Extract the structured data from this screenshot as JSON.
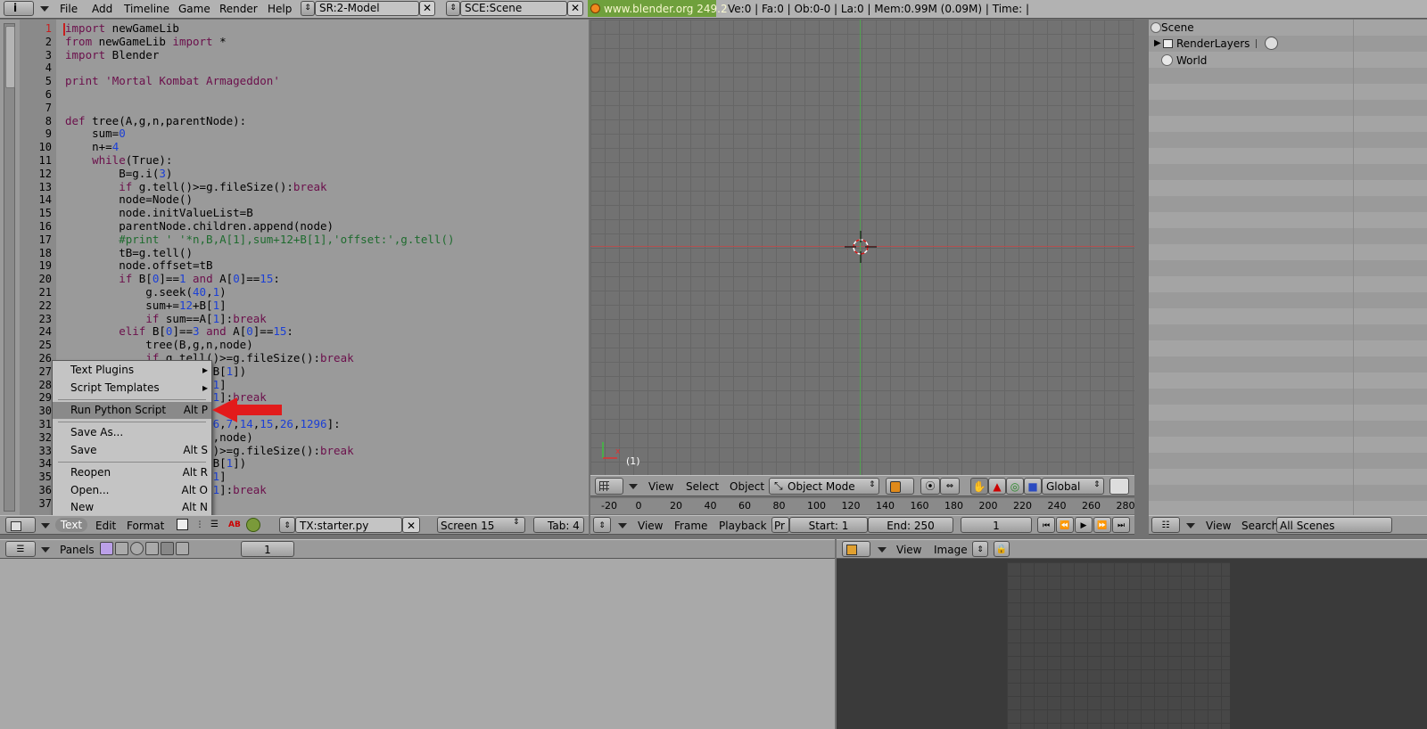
{
  "topbar": {
    "menus": [
      "File",
      "Add",
      "Timeline",
      "Game",
      "Render",
      "Help"
    ],
    "screen_field": "SR:2-Model",
    "scene_field": "SCE:Scene",
    "website": "www.blender.org 249.2",
    "stats": "Ve:0 | Fa:0 | Ob:0-0 | La:0  | Mem:0.99M (0.09M)  | Time: |"
  },
  "code_lines": [
    {
      "n": "1",
      "html": "<span class=\"kw\">import</span> newGameLib"
    },
    {
      "n": "2",
      "html": "<span class=\"kw\">from</span> newGameLib <span class=\"kw\">import</span> *"
    },
    {
      "n": "3",
      "html": "<span class=\"kw\">import</span> Blender"
    },
    {
      "n": "4",
      "html": ""
    },
    {
      "n": "5",
      "html": "<span class=\"kw\">print</span> <span class=\"str\">'Mortal Kombat Armageddon'</span>"
    },
    {
      "n": "6",
      "html": ""
    },
    {
      "n": "7",
      "html": ""
    },
    {
      "n": "8",
      "html": "<span class=\"kw\">def</span> tree(A,g,n,parentNode):"
    },
    {
      "n": "9",
      "html": "    sum=<span class=\"num\">0</span>"
    },
    {
      "n": "10",
      "html": "    n+=<span class=\"num\">4</span>"
    },
    {
      "n": "11",
      "html": "    <span class=\"kw\">while</span>(True):"
    },
    {
      "n": "12",
      "html": "        B=g.i(<span class=\"num\">3</span>)"
    },
    {
      "n": "13",
      "html": "        <span class=\"kw\">if</span> g.tell()&gt;=g.fileSize():<span class=\"kw\">break</span>"
    },
    {
      "n": "14",
      "html": "        node=Node()"
    },
    {
      "n": "15",
      "html": "        node.initValueList=B"
    },
    {
      "n": "16",
      "html": "        parentNode.children.append(node)"
    },
    {
      "n": "17",
      "html": "        <span class=\"cm\">#print ' '*n,B,A[1],sum+12+B[1],'offset:',g.tell()</span>"
    },
    {
      "n": "18",
      "html": "        tB=g.tell()"
    },
    {
      "n": "19",
      "html": "        node.offset=tB"
    },
    {
      "n": "20",
      "html": "        <span class=\"kw\">if</span> B[<span class=\"num\">0</span>]==<span class=\"num\">1</span> <span class=\"kw\">and</span> A[<span class=\"num\">0</span>]==<span class=\"num\">15</span>:"
    },
    {
      "n": "21",
      "html": "            g.seek(<span class=\"num\">40</span>,<span class=\"num\">1</span>)"
    },
    {
      "n": "22",
      "html": "            sum+=<span class=\"num\">12</span>+B[<span class=\"num\">1</span>]"
    },
    {
      "n": "23",
      "html": "            <span class=\"kw\">if</span> sum==A[<span class=\"num\">1</span>]:<span class=\"kw\">break</span>"
    },
    {
      "n": "24",
      "html": "        <span class=\"kw\">elif</span> B[<span class=\"num\">0</span>]==<span class=\"num\">3</span> <span class=\"kw\">and</span> A[<span class=\"num\">0</span>]==<span class=\"num\">15</span>:"
    },
    {
      "n": "25",
      "html": "            tree(B,g,n,node)"
    },
    {
      "n": "26",
      "html": "            <span class=\"kw\">if</span> g.tell()&gt;=g.fileSize():<span class=\"kw\">break</span>"
    },
    {
      "n": "27",
      "html": "                     +B[<span class=\"num\">1</span>])"
    },
    {
      "n": "28",
      "html": "                     [<span class=\"num\">1</span>]"
    },
    {
      "n": "29",
      "html": "                     [<span class=\"num\">1</span>]:<span class=\"kw\">break</span>"
    },
    {
      "n": "30",
      "html": ""
    },
    {
      "n": "31",
      "html": "                     [<span class=\"num\">6</span>,<span class=\"num\">7</span>,<span class=\"num\">14</span>,<span class=\"num\">15</span>,<span class=\"num\">26</span>,<span class=\"num\">1296</span>]:"
    },
    {
      "n": "32",
      "html": "                     n,node)"
    },
    {
      "n": "33",
      "html": "                     ()&gt;=g.fileSize():<span class=\"kw\">break</span>"
    },
    {
      "n": "34",
      "html": "                     +B[<span class=\"num\">1</span>])"
    },
    {
      "n": "35",
      "html": "                     [<span class=\"num\">1</span>]"
    },
    {
      "n": "36",
      "html": "                     [<span class=\"num\">1</span>]:<span class=\"kw\">break</span>"
    },
    {
      "n": "37",
      "html": ""
    }
  ],
  "popup": {
    "items": [
      {
        "label": "Text Plugins",
        "shortcut": "",
        "submenu": true
      },
      {
        "label": "Script Templates",
        "shortcut": "",
        "submenu": true
      },
      {
        "label": "Run Python Script",
        "shortcut": "Alt P",
        "highlight": true
      },
      {
        "label": "Save As...",
        "shortcut": ""
      },
      {
        "label": "Save",
        "shortcut": "Alt S"
      },
      {
        "label": "Reopen",
        "shortcut": "Alt R"
      },
      {
        "label": "Open...",
        "shortcut": "Alt O"
      },
      {
        "label": "New",
        "shortcut": "Alt N"
      }
    ]
  },
  "text_header": {
    "menus": [
      "Text",
      "Edit",
      "Format"
    ],
    "file_field": "TX:starter.py",
    "font": "Screen 15",
    "tab": "Tab: 4"
  },
  "view3d": {
    "frame_label": "(1)",
    "axis_x": "x",
    "menus": [
      "View",
      "Select",
      "Object"
    ],
    "mode": "Object Mode",
    "orientation": "Global"
  },
  "timeline": {
    "ticks": [
      "-20",
      "0",
      "20",
      "40",
      "60",
      "80",
      "100",
      "120",
      "140",
      "160",
      "180",
      "200",
      "220",
      "240",
      "260",
      "280"
    ],
    "menus": [
      "View",
      "Frame",
      "Playback"
    ],
    "pr": "Pr",
    "start": "Start: 1",
    "end": "End: 250",
    "current": "1"
  },
  "outliner": {
    "items": [
      "Scene",
      "RenderLayers",
      "World"
    ],
    "menus": [
      "View",
      "Search"
    ],
    "filter": "All Scenes"
  },
  "buttons_header": {
    "label": "Panels",
    "value": "1"
  },
  "image_header": {
    "menus": [
      "View",
      "Image"
    ]
  },
  "colors": {
    "accent_green": "#6fa03c",
    "highlight_menu": "#8a8a8a",
    "arrow_red": "#e21b1b",
    "line_number_red": "#c81e1e"
  }
}
